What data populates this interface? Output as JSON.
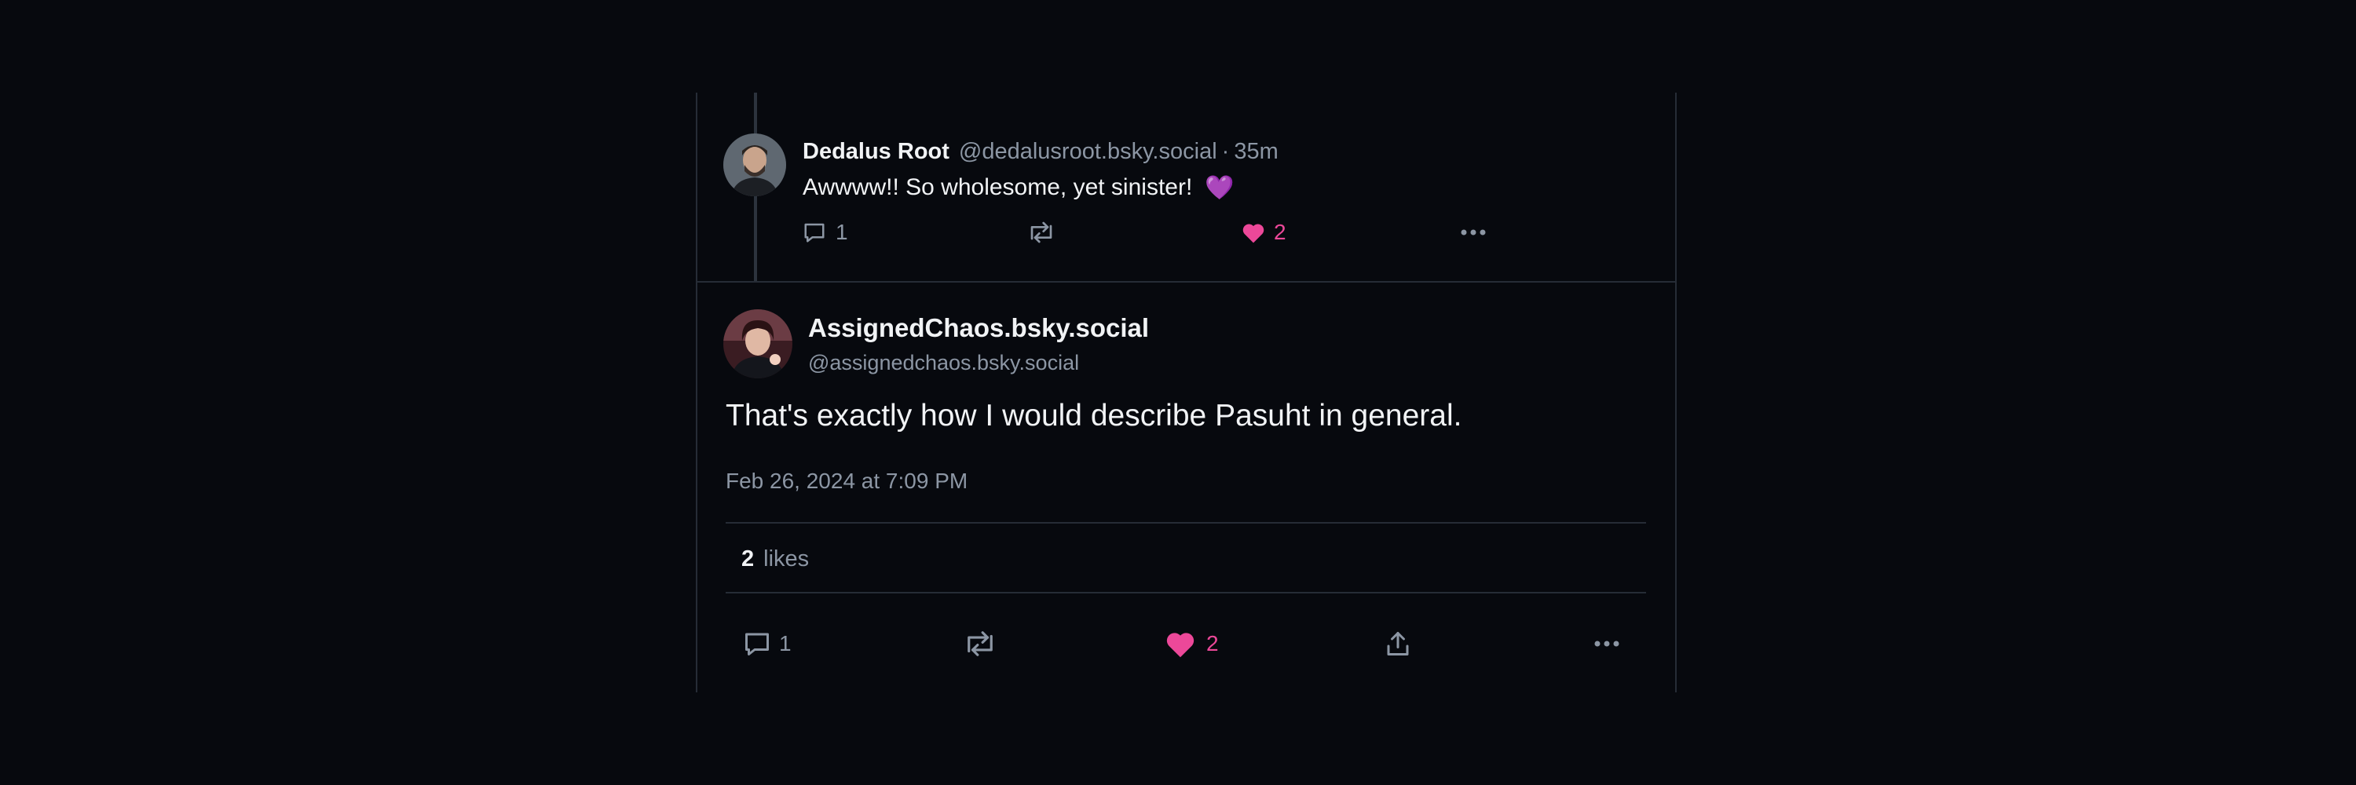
{
  "reply": {
    "display_name": "Dedalus Root",
    "handle": "@dedalusroot.bsky.social",
    "separator": "·",
    "time": "35m",
    "text": "Awwww!! So wholesome, yet sinister!",
    "emoji": "💜",
    "reply_count": "1",
    "like_count": "2",
    "liked": true
  },
  "post": {
    "display_name": "AssignedChaos.bsky.social",
    "handle": "@assignedchaos.bsky.social",
    "text": "That's exactly how I would describe Pasuht in general.",
    "date": "Feb 26, 2024 at 7:09 PM",
    "likes_count": "2",
    "likes_label": "likes",
    "reply_count": "1",
    "like_count": "2",
    "liked": true
  },
  "colors": {
    "background": "#07090e",
    "like_pink": "#ec4899",
    "muted_text": "#8c96a4",
    "primary_text": "#f1f3f5",
    "divider": "#262c36"
  },
  "icons": {
    "reply": "comment-bubble-icon",
    "repost": "repost-arrows-icon",
    "like": "heart-icon",
    "share": "share-upload-icon",
    "more": "more-dots-icon"
  }
}
